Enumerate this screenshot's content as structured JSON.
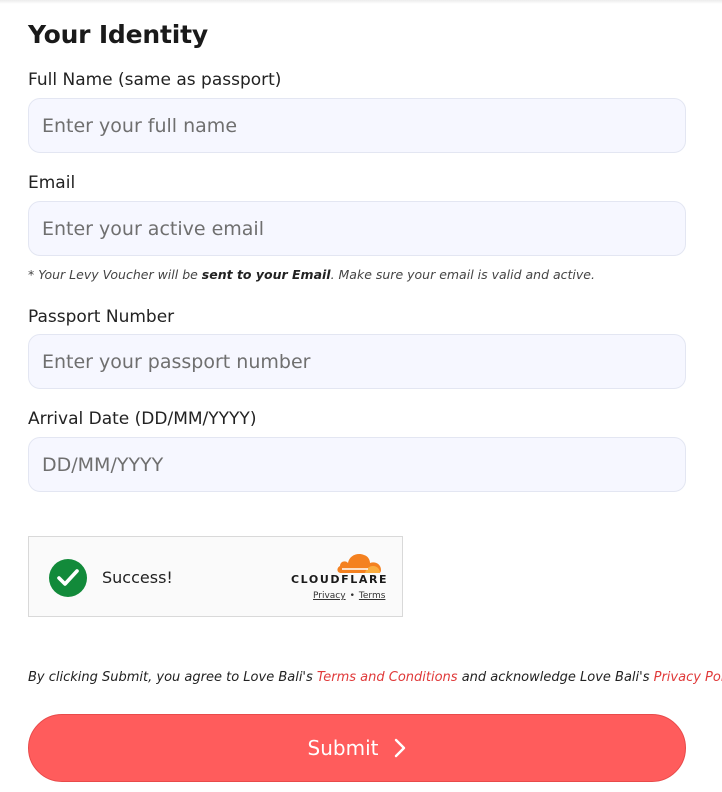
{
  "form": {
    "section_title": "Your Identity",
    "full_name": {
      "label": "Full Name (same as passport)",
      "placeholder": "Enter your full name",
      "value": ""
    },
    "email": {
      "label": "Email",
      "placeholder": "Enter your active email",
      "value": "",
      "note_prefix": "* Your Levy Voucher will be ",
      "note_bold": "sent to your Email",
      "note_suffix": ". Make sure your email is valid and active."
    },
    "passport": {
      "label": "Passport Number",
      "placeholder": "Enter your passport number",
      "value": ""
    },
    "arrival": {
      "label": "Arrival Date (DD/MM/YYYY)",
      "placeholder": "DD/MM/YYYY",
      "value": ""
    }
  },
  "captcha": {
    "status": "Success!",
    "provider": "CLOUDFLARE",
    "privacy_link": "Privacy",
    "separator": "•",
    "terms_link": "Terms",
    "check_icon": "check-circle-icon",
    "status_color": "#128a3a",
    "brand_color": "#f48120"
  },
  "agreement": {
    "prefix": "By clicking Submit, you agree to Love Bali's ",
    "terms_link": "Terms and Conditions",
    "middle": " and acknowledge Love Bali's ",
    "privacy_link": "Privacy Policy",
    "link_color": "#e03a3a"
  },
  "submit": {
    "label": "Submit",
    "icon": "chevron-right-icon",
    "color": "#ff5c5c"
  }
}
